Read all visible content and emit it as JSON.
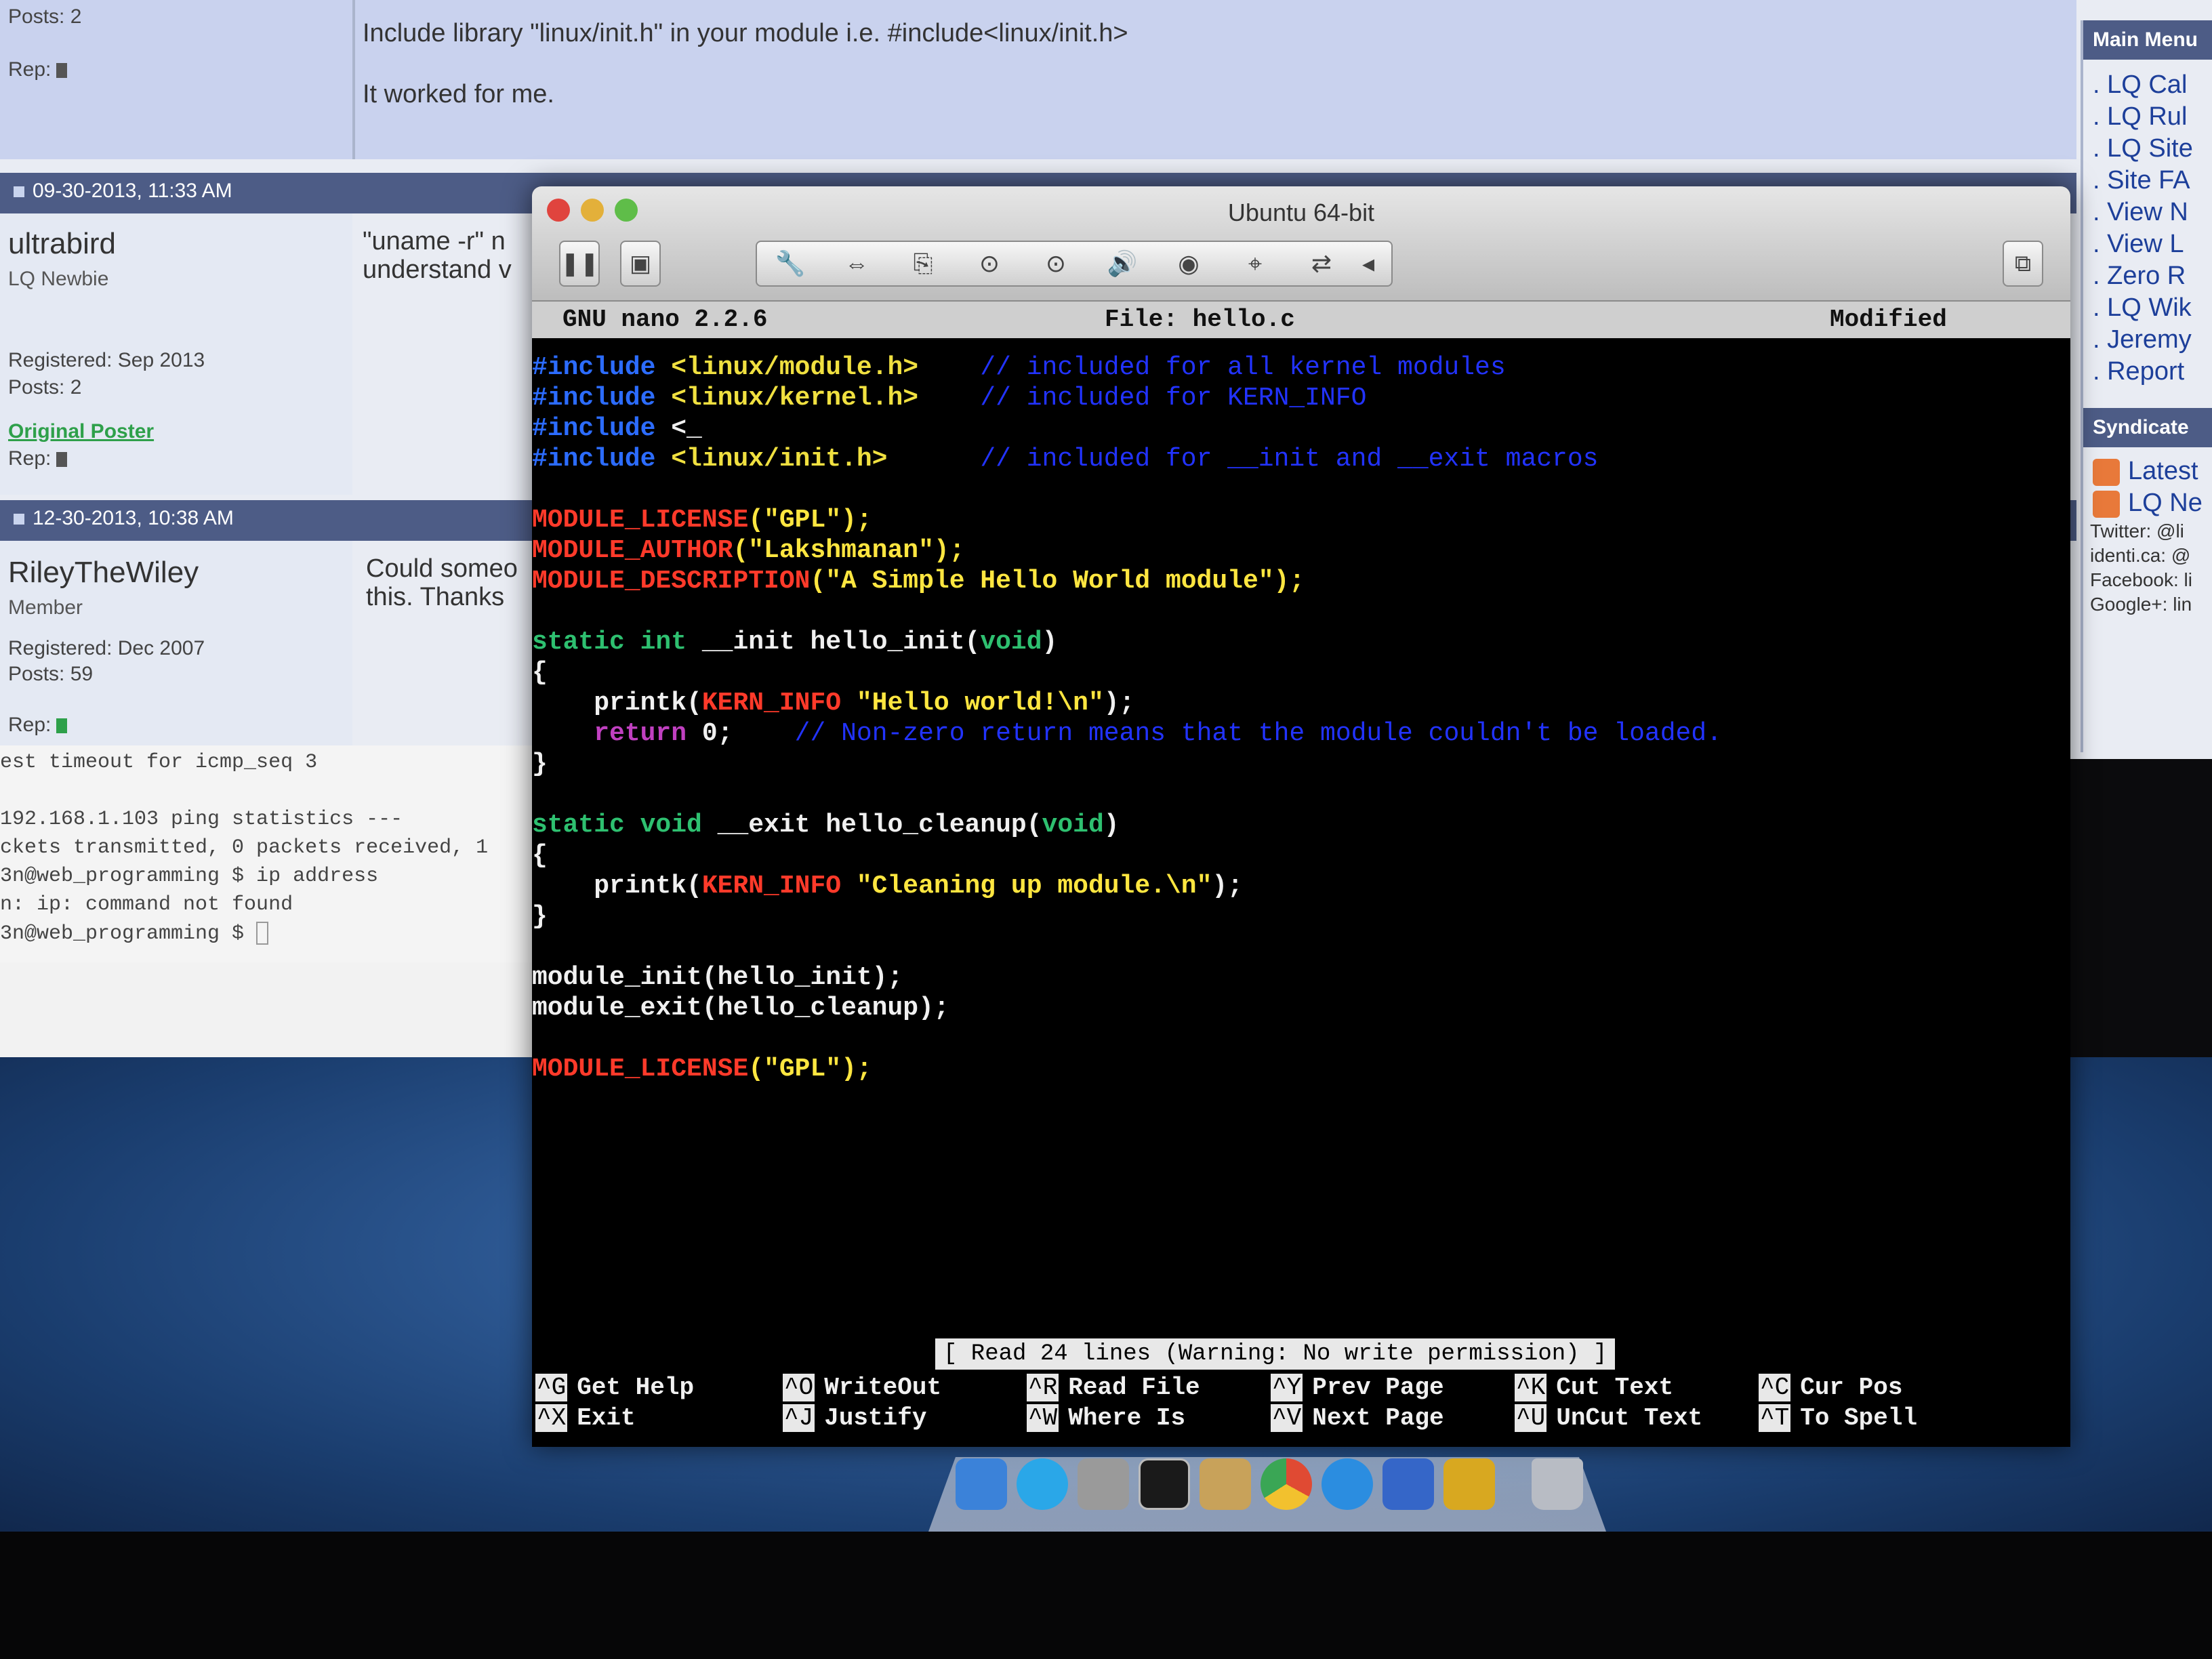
{
  "forum": {
    "top_post": {
      "posts": "Posts: 2",
      "rep": "Rep:",
      "line1": "Include library \"linux/init.h\" in your module i.e. #include<linux/init.h>",
      "line2": "It worked for me."
    },
    "post_ultrabird": {
      "date": "09-30-2013, 11:33 AM",
      "username": "ultrabird",
      "title": "LQ Newbie",
      "registered": "Registered: Sep 2013",
      "posts": "Posts: 2",
      "original_poster": "Original Poster",
      "rep": "Rep:",
      "text_line1": "\"uname -r\" n",
      "text_line2": "understand v"
    },
    "post_riley": {
      "date": "12-30-2013, 10:38 AM",
      "username": "RileyTheWiley",
      "title": "Member",
      "registered": "Registered: Dec 2007",
      "posts": "Posts: 59",
      "rep": "Rep:",
      "text_line1": "Could someo",
      "text_line2": "this. Thanks"
    }
  },
  "sidebar": {
    "main_menu_title": "Main Menu",
    "menu_items": [
      ". LQ Cal",
      ". LQ Rul",
      ". LQ Site",
      ". Site FA",
      ". View N",
      ". View L",
      ". Zero R",
      ". LQ Wik",
      ". Jeremy",
      ". Report"
    ],
    "syndicate_title": "Syndicate",
    "feeds": [
      "Latest",
      "LQ Ne"
    ],
    "social": [
      "Twitter: @li",
      "identi.ca: @",
      "Facebook: li",
      "Google+: lin"
    ]
  },
  "terminal": {
    "lines": [
      "est timeout for icmp_seq 3",
      "",
      "192.168.1.103 ping statistics ---",
      "ckets transmitted, 0 packets received, 1",
      "3n@web_programming $ ip address",
      "n: ip: command not found",
      "3n@web_programming $ "
    ]
  },
  "vm": {
    "title": "Ubuntu 64-bit",
    "toolbar": {
      "pause": "❚❚",
      "snapshot": "▣",
      "tools": [
        "🔧",
        "⇔",
        "⎘",
        "⊙",
        "⊙",
        "🔊",
        "◉",
        "⌖",
        "⇄",
        "◂"
      ],
      "fullscreen": "⧉"
    }
  },
  "nano": {
    "version": "GNU nano 2.2.6",
    "file": "File: hello.c",
    "status": "Modified",
    "message": "[ Read 24 lines (Warning: No write permission) ]",
    "code": {
      "l1_pre": "#include ",
      "l1_hdr": "<linux/module.h>",
      "l1_cmt": "    // included for all kernel modules",
      "l2_pre": "#include ",
      "l2_hdr": "<linux/kernel.h>",
      "l2_cmt": "    // included for KERN_INFO",
      "l3_pre": "#include ",
      "l3_hdr": "<_",
      "l4_pre": "#include ",
      "l4_hdr": "<linux/init.h>",
      "l4_cmt": "      // included for __init and __exit macros",
      "l6_mac": "MODULE_LICENSE",
      "l6_str": "(\"GPL\");",
      "l7_mac": "MODULE_AUTHOR",
      "l7_str": "(\"Lakshmanan\");",
      "l8_mac": "MODULE_DESCRIPTION",
      "l8_str": "(\"A Simple Hello World module\");",
      "l10_kw": "static int",
      "l10_rest": " __init hello_init(",
      "l10_void": "void",
      "l10_end": ")",
      "l11": "{",
      "l12_pre": "    printk(",
      "l12_mac": "KERN_INFO",
      "l12_str": " \"Hello world!\\n\"",
      "l12_end": ");",
      "l13_kw": "    return",
      "l13_rest": " 0;",
      "l13_cmt": "    // Non-zero return means that the module couldn't be loaded.",
      "l14": "}",
      "l16_kw": "static void",
      "l16_rest": " __exit hello_cleanup(",
      "l16_void": "void",
      "l16_end": ")",
      "l17": "{",
      "l18_pre": "    printk(",
      "l18_mac": "KERN_INFO",
      "l18_str": " \"Cleaning up module.\\n\"",
      "l18_end": ");",
      "l19": "}",
      "l21": "module_init(hello_init);",
      "l22": "module_exit(hello_cleanup);",
      "l24_mac": "MODULE_LICENSE",
      "l24_str": "(\"GPL\");"
    },
    "shortcuts": [
      {
        "key1": "^G",
        "label1": "Get Help",
        "key2": "^X",
        "label2": "Exit"
      },
      {
        "key1": "^O",
        "label1": "WriteOut",
        "key2": "^J",
        "label2": "Justify"
      },
      {
        "key1": "^R",
        "label1": "Read File",
        "key2": "^W",
        "label2": "Where Is"
      },
      {
        "key1": "^Y",
        "label1": "Prev Page",
        "key2": "^V",
        "label2": "Next Page"
      },
      {
        "key1": "^K",
        "label1": "Cut Text",
        "key2": "^U",
        "label2": "UnCut Text"
      },
      {
        "key1": "^C",
        "label1": "Cur Pos",
        "key2": "^T",
        "label2": "To Spell"
      }
    ]
  },
  "dock": {
    "icons": [
      "finder-icon",
      "app-store-icon",
      "system-preferences-icon",
      "terminal-icon",
      "preview-icon",
      "chrome-icon",
      "itunes-icon",
      "vmware-fusion-icon",
      "stickies-icon",
      "trash-icon"
    ],
    "colors": [
      "#3b82d9",
      "#2aa7e8",
      "#9a9a9a",
      "#1a1a1a",
      "#c8a25a",
      "#e04a33",
      "#2b8de0",
      "#3566c8",
      "#d8a820",
      "#b8bcc4"
    ]
  }
}
